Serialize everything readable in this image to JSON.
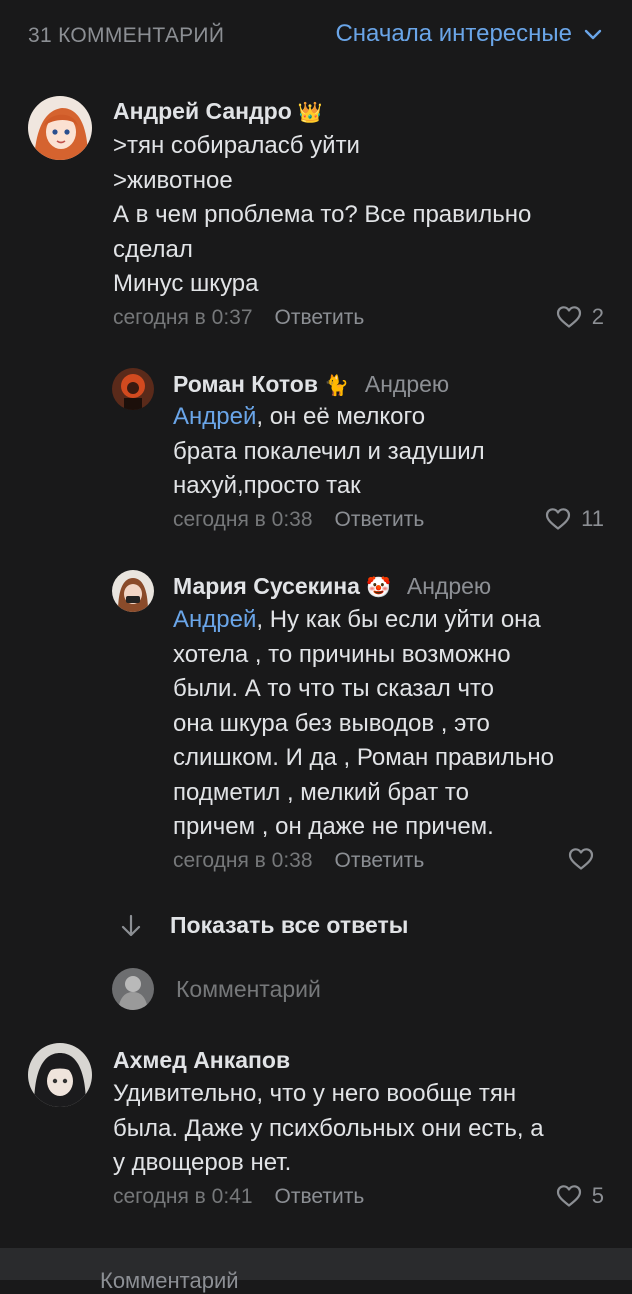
{
  "header": {
    "count_label": "31 КОММЕНТАРИЙ",
    "sort_label": "Сначала интересные"
  },
  "comments": [
    {
      "author": "Андрей Сандро",
      "badge": "👑",
      "lines": [
        ">тян собираласб уйти",
        ">животное",
        "А в чем рпоблема то? Все правильно",
        "сделал",
        "Минус шкура"
      ],
      "time": "сегодня в 0:37",
      "reply_label": "Ответить",
      "likes": "2"
    },
    {
      "author": "Роман Котов",
      "badge": "🐈",
      "reply_to": "Андрею",
      "mention": "Андрей",
      "lines": [
        ", он её мелкого",
        "брата покалечил и задушил",
        "нахуй,просто так"
      ],
      "time": "сегодня в 0:38",
      "reply_label": "Ответить",
      "likes": "11"
    },
    {
      "author": "Мария Сусекина",
      "badge": "🤡",
      "reply_to": "Андрею",
      "mention": "Андрей",
      "lines": [
        ", Ну как бы если уйти она",
        "хотела , то причины возможно",
        "были. А то что ты сказал что",
        "она шкура без выводов , это",
        "слишком. И да , Роман правильно",
        "подметил , мелкий брат то",
        "причем , он даже не причем."
      ],
      "time": "сегодня в 0:38",
      "reply_label": "Ответить",
      "likes": ""
    },
    {
      "author": "Ахмед Анкапов",
      "lines": [
        "Удивительно, что у него вообще тян",
        "была. Даже у психбольных они есть, а",
        "у двощеров нет."
      ],
      "time": "сегодня в 0:41",
      "reply_label": "Ответить",
      "likes": "5"
    }
  ],
  "thread": {
    "show_all_label": "Показать все ответы",
    "comment_placeholder": "Комментарий"
  },
  "bottom_bar": {
    "label": "Комментарий"
  },
  "colors": {
    "background": "#19191a",
    "accent": "#6aa5e8",
    "text": "#e1e3e6",
    "secondary": "#8c8f94"
  },
  "icons": [
    "chevron-down-icon",
    "heart-icon",
    "arrow-down-icon"
  ]
}
